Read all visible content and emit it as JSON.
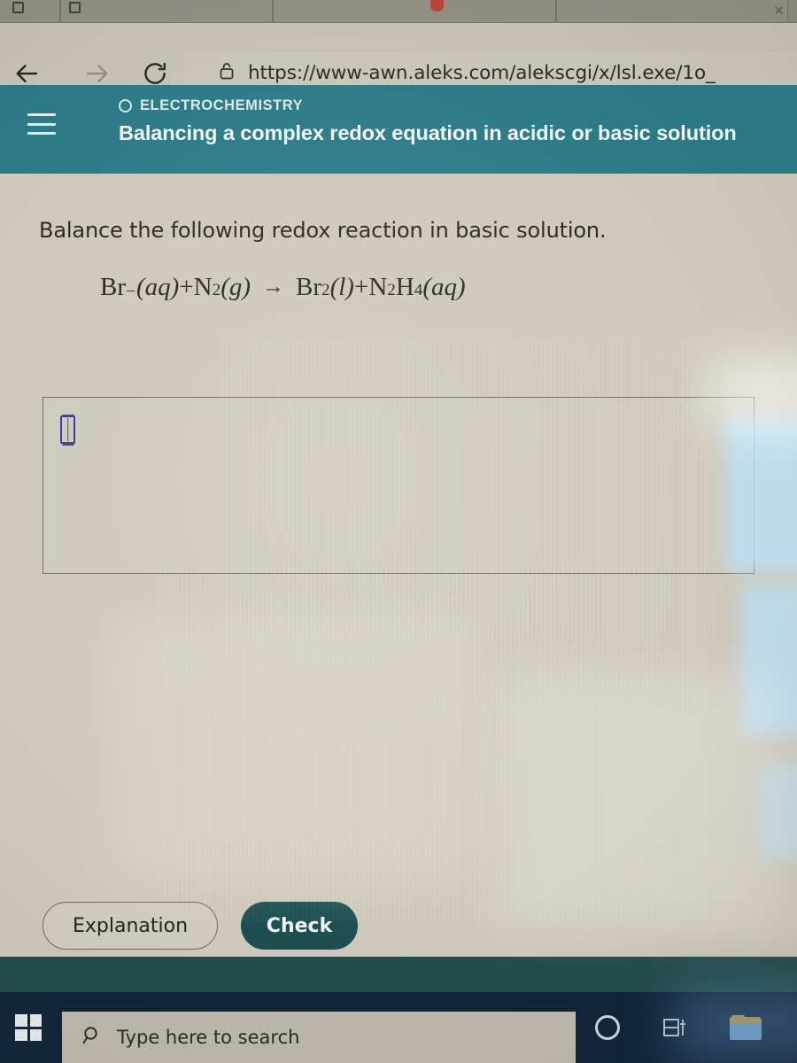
{
  "browser": {
    "tab_close_glyph": "✕",
    "nav": {
      "back_label": "Back",
      "forward_label": "Forward",
      "reload_label": "Reload"
    },
    "address_bar": {
      "url": "https://www-awn.aleks.com/alekscgi/x/lsl.exe/1o_",
      "lock_icon": "lock-icon"
    }
  },
  "aleks": {
    "menu_icon": "hamburger-menu-icon",
    "topic": "ELECTROCHEMISTRY",
    "lesson_title": "Balancing a complex redox equation in acidic or basic solution",
    "collapse_icon": "chevron-down-icon"
  },
  "question": {
    "prompt": "Balance the following redox reaction in basic solution.",
    "equation_plain": "Br⁻(aq)+N₂(g) → Br₂(l)+N₂H₄(aq)",
    "equation": {
      "reactant1_symbol": "Br",
      "reactant1_charge": "–",
      "reactant1_state": "(aq)",
      "plus1": "+",
      "reactant2_symbol": "N",
      "reactant2_sub": "2",
      "reactant2_state": "(g)",
      "arrow": "→",
      "product1_symbol": "Br",
      "product1_sub": "2",
      "product1_state": "(l)",
      "plus2": "+",
      "product2_symbol_n": "N",
      "product2_sub_n": "2",
      "product2_symbol_h": "H",
      "product2_sub_h": "4",
      "product2_state": "(aq)"
    }
  },
  "answer_area": {
    "value": "",
    "placeholder": "",
    "caret_name": "answer-entry-caret"
  },
  "actions": {
    "explanation_label": "Explanation",
    "check_label": "Check"
  },
  "taskbar": {
    "start_label": "Start",
    "search_placeholder": "Type here to search",
    "search_icon": "search-icon",
    "cortana_label": "Cortana",
    "taskview_label": "Task View",
    "explorer_label": "File Explorer"
  },
  "colors": {
    "header_teal": "#2b7a86",
    "accent_dark_teal": "#1d4f52",
    "footer_teal": "#234b4b",
    "collapse_tab": "#9dc8c9",
    "page_bg": "#cdc8ba",
    "taskbar": "#10243b",
    "caret_blue": "#3b2fa8"
  }
}
